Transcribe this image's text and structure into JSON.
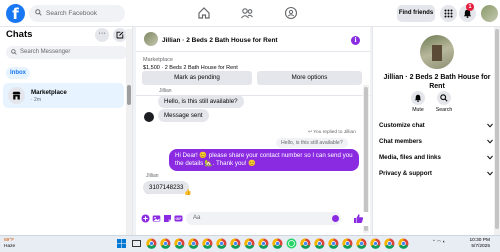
{
  "topbar": {
    "logo": "f",
    "search_placeholder": "Search Facebook",
    "find_friends": "Find friends",
    "notification_count": "1"
  },
  "sidebar": {
    "title": "Chats",
    "more": "···",
    "search_placeholder": "Search Messenger",
    "tab_inbox": "Inbox",
    "conversation": {
      "name": "Marketplace",
      "time": "· 2m"
    }
  },
  "chat": {
    "title": "Jillian · 2 Beds 2 Bath House for Rent",
    "info_icon": "i",
    "listing_label": "Marketplace",
    "listing_detail": "$1,500 · 2 Beds 2 Bath House for Rent",
    "mark_pending": "Mark as pending",
    "more_options": "More options",
    "messages": {
      "sender1": "Jillian",
      "msg1": "Hello, is this still available?",
      "msg2": "Message sent",
      "reply_note": "↩ You replied to Jillian",
      "reply_quote": "Hello, is this still available?",
      "msg3": "Hi Dear! 😊 please share your contact number       so I can send you the details 🏡. Thank you! 😊",
      "sender2": "Jillian",
      "msg4": "3107148233",
      "reaction": "👍"
    },
    "composer_placeholder": "Aa"
  },
  "info_panel": {
    "title": "Jillian · 2 Beds 2 Bath House for Rent",
    "mute": "Mute",
    "search": "Search",
    "sections": [
      "Customize chat",
      "Chat members",
      "Media, files and links",
      "Privacy & support"
    ]
  },
  "taskbar": {
    "temperature": "89°F",
    "condition": "Haze",
    "time": "10:30 PM",
    "date": "5/7/2025"
  }
}
